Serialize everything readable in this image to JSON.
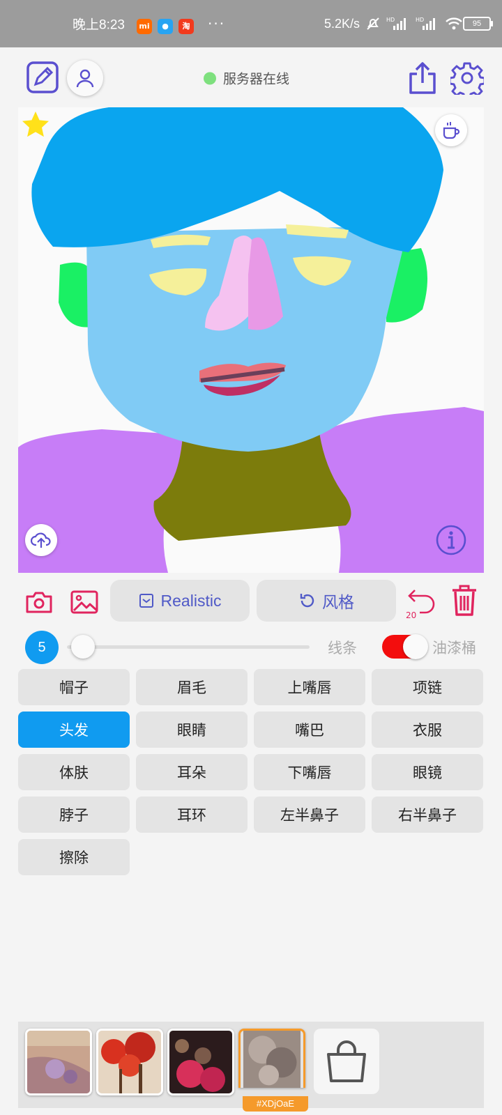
{
  "status_bar": {
    "time": "晚上8:23",
    "app_icons": [
      {
        "name": "mi-app-icon",
        "color": "#ff6a00",
        "text": "mi"
      },
      {
        "name": "messenger-app-icon",
        "color": "#27a4f2",
        "text": ""
      },
      {
        "name": "taobao-app-icon",
        "color": "#f23a1d",
        "text": "淘"
      }
    ],
    "dots": "···",
    "net_speed": "5.2K/s",
    "battery": "95"
  },
  "header": {
    "server_status": "服务器在线",
    "server_status_color": "#7ee07e"
  },
  "tools": {
    "style_chip": "Realistic",
    "style_button": "风格",
    "undo_count": "20"
  },
  "brush": {
    "size": "5",
    "size_level": 0.02,
    "lines_label": "线条",
    "bucket_label": "油漆桶",
    "bucket_enabled": true
  },
  "parts": [
    {
      "label": "帽子",
      "active": false
    },
    {
      "label": "眉毛",
      "active": false
    },
    {
      "label": "上嘴唇",
      "active": false
    },
    {
      "label": "项链",
      "active": false
    },
    {
      "label": "头发",
      "active": true
    },
    {
      "label": "眼睛",
      "active": false
    },
    {
      "label": "嘴巴",
      "active": false
    },
    {
      "label": "衣服",
      "active": false
    },
    {
      "label": "体肤",
      "active": false
    },
    {
      "label": "耳朵",
      "active": false
    },
    {
      "label": "下嘴唇",
      "active": false
    },
    {
      "label": "眼镜",
      "active": false
    },
    {
      "label": "脖子",
      "active": false
    },
    {
      "label": "耳环",
      "active": false
    },
    {
      "label": "左半鼻子",
      "active": false
    },
    {
      "label": "右半鼻子",
      "active": false
    },
    {
      "label": "擦除",
      "active": false
    }
  ],
  "gallery": {
    "selected_tag": "#XDjOaE"
  },
  "colors": {
    "accent_purple": "#5a4fcf",
    "danger_red": "#e0245e",
    "active_blue": "#109bf0",
    "hair": "#0aa5ef",
    "skin": "#80cbf5",
    "ears": "#1af064",
    "clothes": "#c77df7",
    "neck": "#7c7c0c"
  }
}
